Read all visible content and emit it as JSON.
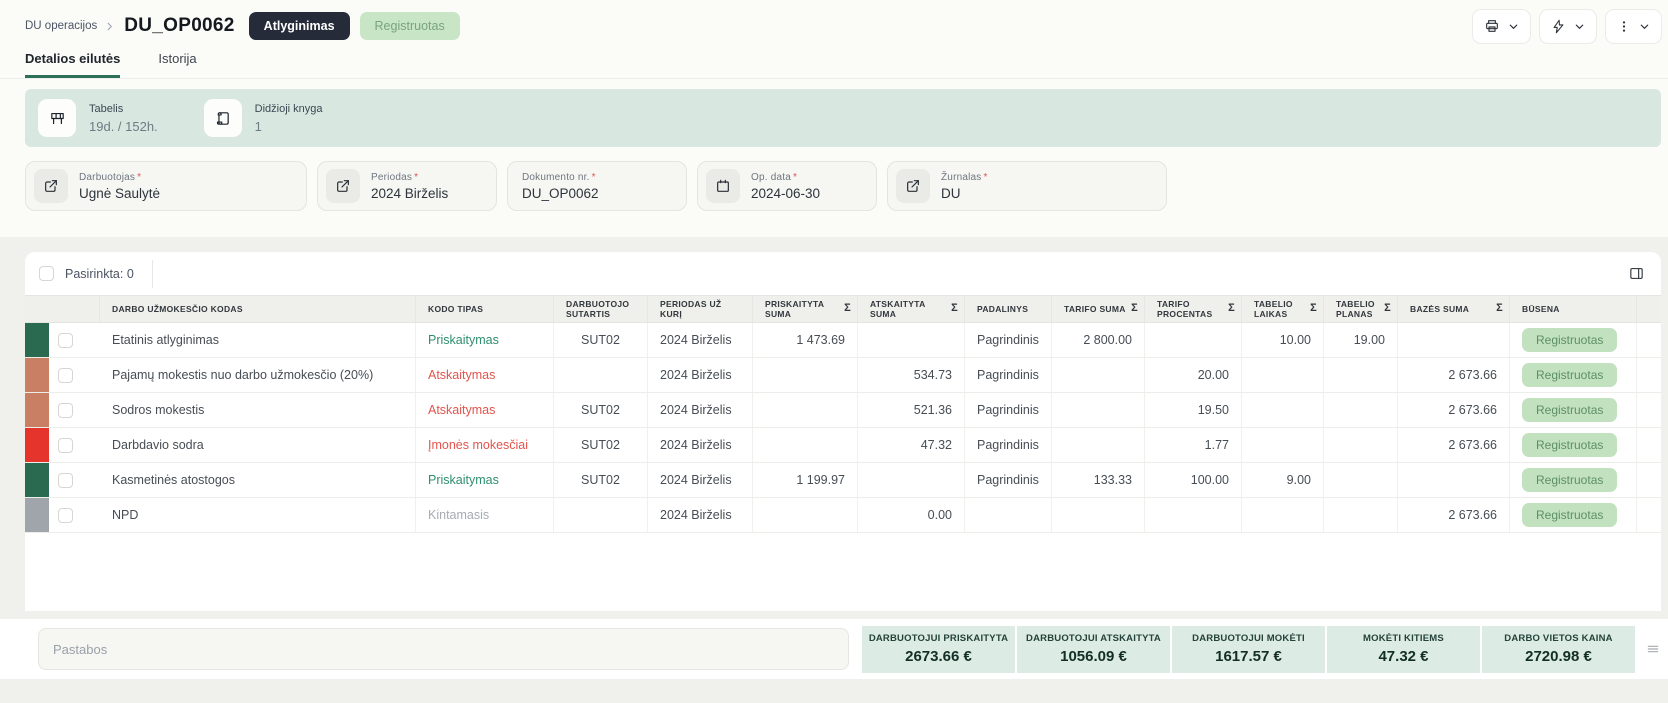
{
  "header": {
    "breadcrumb_root": "DU operacijos",
    "title": "DU_OP0062",
    "type_badge": "Atlyginimas",
    "status_badge": "Registruotas"
  },
  "tabs": {
    "details": "Detalios eilutės",
    "history": "Istorija"
  },
  "banner": {
    "items": [
      {
        "icon": "timesheet-table-icon",
        "label": "Tabelis",
        "value": "19d. / 152h."
      },
      {
        "icon": "ledger-scroll-icon",
        "label": "Didžioji knyga",
        "value": "1"
      }
    ]
  },
  "form": {
    "required_mark": "*",
    "fields": [
      {
        "icon": "external-link-icon",
        "label": "Darbuotojas",
        "value": "Ugnė Saulytė"
      },
      {
        "icon": "external-link-icon",
        "label": "Periodas",
        "value": "2024 Birželis"
      },
      {
        "icon": "none",
        "label": "Dokumento nr.",
        "value": "DU_OP0062"
      },
      {
        "icon": "calendar-icon",
        "label": "Op. data",
        "value": "2024-06-30"
      },
      {
        "icon": "external-link-icon",
        "label": "Žurnalas",
        "value": "DU"
      }
    ]
  },
  "table": {
    "selected_label": "Pasirinkta: 0",
    "sum_symbol": "Σ",
    "columns": [
      {
        "label": "DARBO UŽMOKESČIO KODAS"
      },
      {
        "label": "KODO TIPAS"
      },
      {
        "label": "DARBUOTOJO SUTARTIS"
      },
      {
        "label": "PERIODAS UŽ KURĮ"
      },
      {
        "label": "PRISKAITYTA SUMA"
      },
      {
        "label": "ATSKAITYTA SUMA"
      },
      {
        "label": "PADALINYS"
      },
      {
        "label": "TARIFO SUMA"
      },
      {
        "label": "TARIFO PROCENTAS"
      },
      {
        "label": "TABELIO LAIKAS"
      },
      {
        "label": "TABELIO PLANAS"
      },
      {
        "label": "BAZĖS SUMA"
      },
      {
        "label": "BŪSENA"
      }
    ],
    "type_colors": {
      "accrual": "#2f8f6d",
      "deduction": "#e2544d",
      "variable": "#a6acb3"
    },
    "rows": [
      {
        "bar_style": "background:#2a6a50",
        "code": "Etatinis atlyginimas",
        "type": "Priskaitymas",
        "type_style": "color:#2f8f6d",
        "contract": "SUT02",
        "period": "2024 Birželis",
        "accrued": "1 473.69",
        "deducted": "",
        "department": "Pagrindinis",
        "rate_sum": "2 800.00",
        "rate_percent": "",
        "timesheet_time": "10.00",
        "timesheet_plan": "19.00",
        "base_sum": "",
        "status": "Registruotas"
      },
      {
        "bar_style": "background:#c97f63",
        "code": "Pajamų mokestis nuo darbo užmokesčio (20%)",
        "type": "Atskaitymas",
        "type_style": "color:#e2544d",
        "contract": "",
        "period": "2024 Birželis",
        "accrued": "",
        "deducted": "534.73",
        "department": "Pagrindinis",
        "rate_sum": "",
        "rate_percent": "20.00",
        "timesheet_time": "",
        "timesheet_plan": "",
        "base_sum": "2 673.66",
        "status": "Registruotas"
      },
      {
        "bar_style": "background:#c97f63",
        "code": "Sodros mokestis",
        "type": "Atskaitymas",
        "type_style": "color:#e2544d",
        "contract": "SUT02",
        "period": "2024 Birželis",
        "accrued": "",
        "deducted": "521.36",
        "department": "Pagrindinis",
        "rate_sum": "",
        "rate_percent": "19.50",
        "timesheet_time": "",
        "timesheet_plan": "",
        "base_sum": "2 673.66",
        "status": "Registruotas"
      },
      {
        "bar_style": "background:#e5342c",
        "code": "Darbdavio sodra",
        "type": "Įmonės mokesčiai",
        "type_style": "color:#e2544d",
        "contract": "SUT02",
        "period": "2024 Birželis",
        "accrued": "",
        "deducted": "47.32",
        "department": "Pagrindinis",
        "rate_sum": "",
        "rate_percent": "1.77",
        "timesheet_time": "",
        "timesheet_plan": "",
        "base_sum": "2 673.66",
        "status": "Registruotas"
      },
      {
        "bar_style": "background:#2a6a50",
        "code": "Kasmetinės atostogos",
        "type": "Priskaitymas",
        "type_style": "color:#2f8f6d",
        "contract": "SUT02",
        "period": "2024 Birželis",
        "accrued": "1 199.97",
        "deducted": "",
        "department": "Pagrindinis",
        "rate_sum": "133.33",
        "rate_percent": "100.00",
        "timesheet_time": "9.00",
        "timesheet_plan": "",
        "base_sum": "",
        "status": "Registruotas"
      },
      {
        "bar_style": "background:#9fa5ab",
        "code": "NPD",
        "type": "Kintamasis",
        "type_style": "color:#a6acb3",
        "contract": "",
        "period": "2024 Birželis",
        "accrued": "",
        "deducted": "0.00",
        "department": "",
        "rate_sum": "",
        "rate_percent": "",
        "timesheet_time": "",
        "timesheet_plan": "",
        "base_sum": "2 673.66",
        "status": "Registruotas"
      }
    ]
  },
  "footer": {
    "notes_placeholder": "Pastabos",
    "metrics": [
      {
        "label": "DARBUOTOJUI PRISKAITYTA",
        "value": "2673.66 €"
      },
      {
        "label": "DARBUOTOJUI ATSKAITYTA",
        "value": "1056.09 €"
      },
      {
        "label": "DARBUOTOJUI MOKĖTI",
        "value": "1617.57 €"
      },
      {
        "label": "MOKĖTI KITIEMS",
        "value": "47.32 €"
      },
      {
        "label": "DARBO VIETOS KAINA",
        "value": "2720.98 €"
      }
    ]
  },
  "colors": {
    "accent_green": "#2c7057",
    "banner_bg": "#d8e8e1",
    "badge_dark_bg": "#252b38",
    "badge_green_bg": "#c8e5c6",
    "status_badge_bg": "#c2e1bf",
    "status_badge_text": "#5d8f66",
    "required_red": "#e0524e"
  }
}
